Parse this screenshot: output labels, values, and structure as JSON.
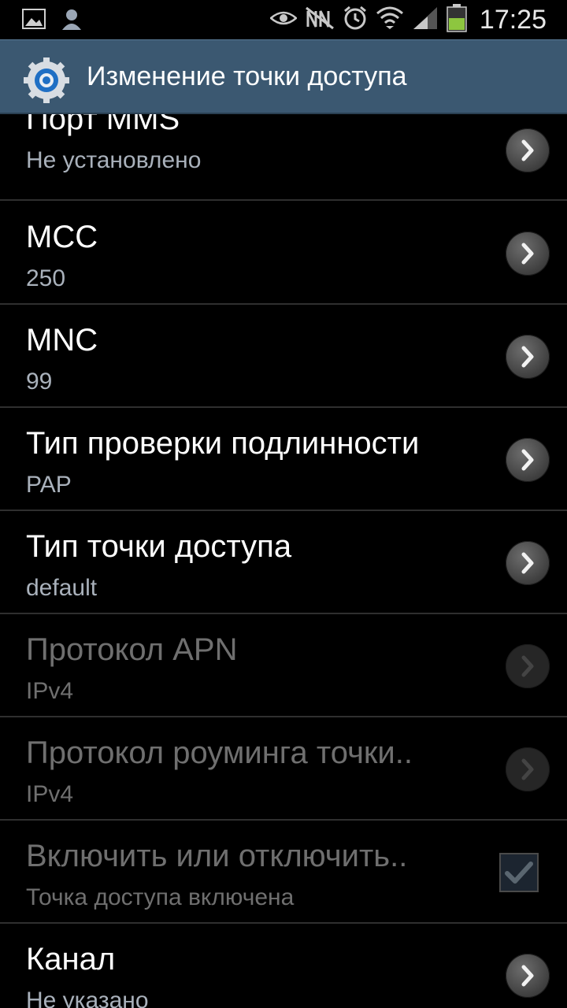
{
  "status_bar": {
    "time": "17:25",
    "icons_left": [
      "gallery-icon",
      "contact-icon"
    ],
    "icons_right": [
      "smart-stay-eye-icon",
      "no-sim-icon",
      "alarm-icon",
      "wifi-icon",
      "signal-icon",
      "battery-icon"
    ]
  },
  "action_bar": {
    "title": "Изменение точки доступа",
    "icon": "settings-gear-icon"
  },
  "items": [
    {
      "title": "Порт MMS",
      "summary": "Не установлено",
      "enabled": true,
      "control": "chevron"
    },
    {
      "title": "MCC",
      "summary": "250",
      "enabled": true,
      "control": "chevron"
    },
    {
      "title": "MNC",
      "summary": "99",
      "enabled": true,
      "control": "chevron"
    },
    {
      "title": "Тип проверки подлинности",
      "summary": "PAP",
      "enabled": true,
      "control": "chevron"
    },
    {
      "title": "Тип точки доступа",
      "summary": "default",
      "enabled": true,
      "control": "chevron"
    },
    {
      "title": "Протокол APN",
      "summary": "IPv4",
      "enabled": false,
      "control": "chevron"
    },
    {
      "title": "Протокол роуминга точки..",
      "summary": "IPv4",
      "enabled": false,
      "control": "chevron"
    },
    {
      "title": "Включить или отключить..",
      "summary": "Точка доступа включена",
      "enabled": false,
      "control": "checkbox",
      "checked": true
    },
    {
      "title": "Канал",
      "summary": "Не указано",
      "enabled": true,
      "control": "chevron"
    }
  ],
  "colors": {
    "action_bar": "#3b5871",
    "background": "#000000",
    "summary_text": "#a9b1bb",
    "disabled_text": "#6f6f6f"
  }
}
